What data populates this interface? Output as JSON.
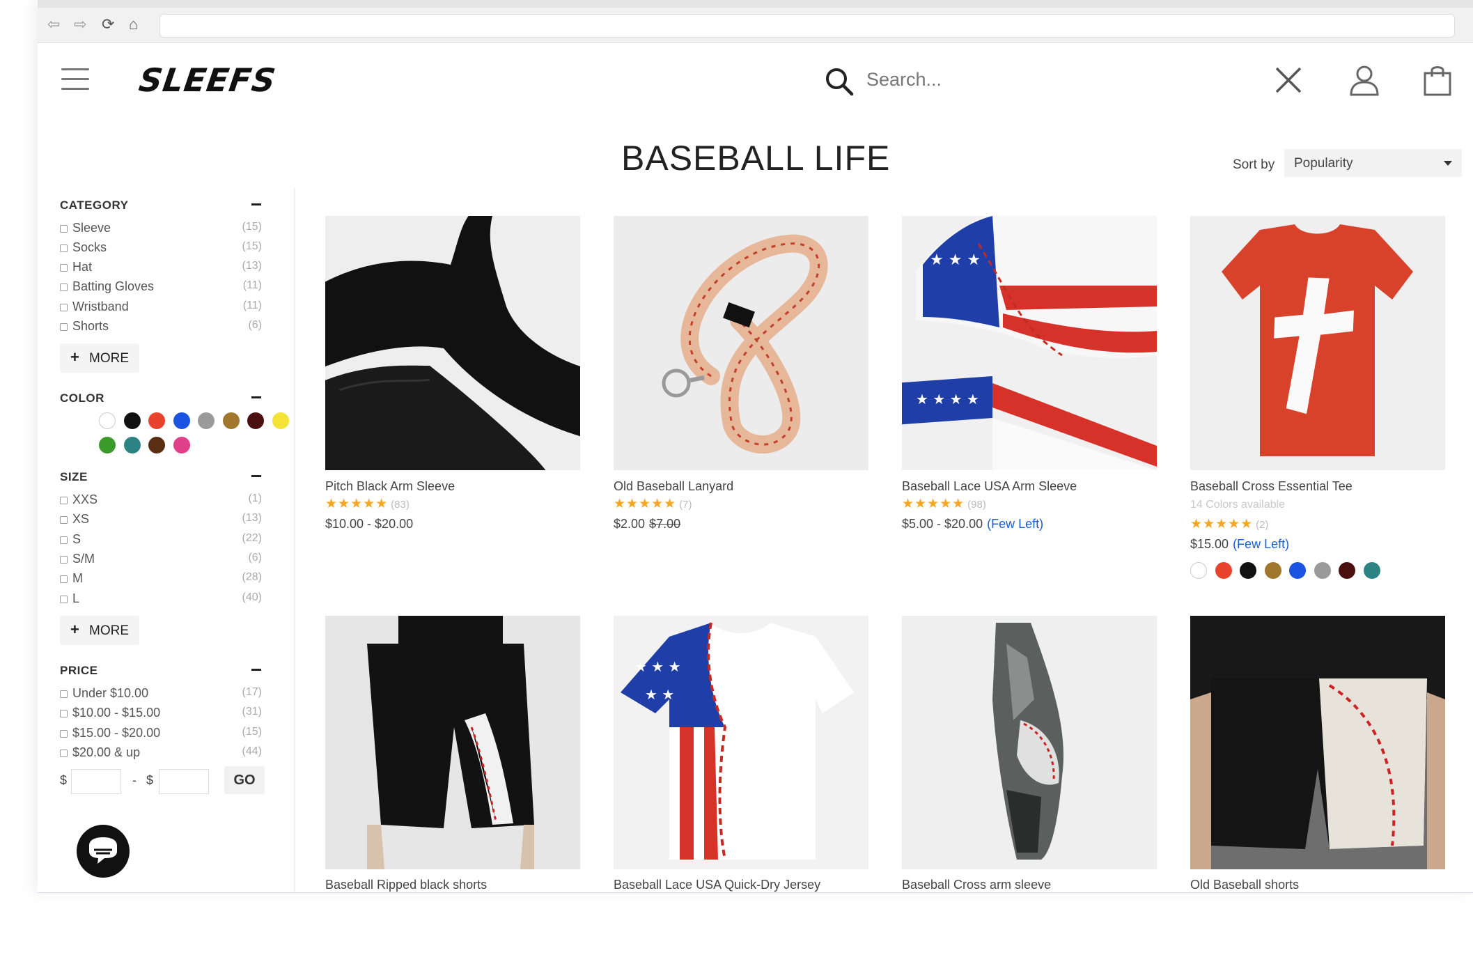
{
  "header": {
    "logo": "SLEEFS",
    "search_placeholder": "Search..."
  },
  "page": {
    "title": "BASEBALL LIFE",
    "sort_label": "Sort by",
    "sort_value": "Popularity"
  },
  "filters": {
    "category": {
      "heading": "CATEGORY",
      "items": [
        {
          "label": "Sleeve",
          "count": "(15)"
        },
        {
          "label": "Socks",
          "count": "(15)"
        },
        {
          "label": "Hat",
          "count": "(13)"
        },
        {
          "label": "Batting Gloves",
          "count": "(11)"
        },
        {
          "label": "Wristband",
          "count": "(11)"
        },
        {
          "label": "Shorts",
          "count": "(6)"
        }
      ],
      "more_label": "MORE"
    },
    "color": {
      "heading": "COLOR",
      "swatches": [
        "#ffffff",
        "#111111",
        "#e8432d",
        "#1a54e0",
        "#9a9a9a",
        "#a0772c",
        "#4a1010",
        "#f4e334",
        "#3a9a2a",
        "#2d8383",
        "#5a2e12",
        "#e0408a"
      ]
    },
    "size": {
      "heading": "SIZE",
      "items": [
        {
          "label": "XXS",
          "count": "(1)"
        },
        {
          "label": "XS",
          "count": "(13)"
        },
        {
          "label": "S",
          "count": "(22)"
        },
        {
          "label": "S/M",
          "count": "(6)"
        },
        {
          "label": "M",
          "count": "(28)"
        },
        {
          "label": "L",
          "count": "(40)"
        }
      ],
      "more_label": "MORE"
    },
    "price": {
      "heading": "PRICE",
      "items": [
        {
          "label": "Under $10.00",
          "count": "(17)"
        },
        {
          "label": "$10.00 - $15.00",
          "count": "(31)"
        },
        {
          "label": "$15.00 - $20.00",
          "count": "(15)"
        },
        {
          "label": "$20.00 & up",
          "count": "(44)"
        }
      ],
      "currency": "$",
      "dash": "-",
      "go_label": "GO"
    }
  },
  "products": [
    {
      "name": "Pitch Black Arm Sleeve",
      "stars": "★★★★★",
      "reviews": "(83)",
      "price": "$10.00 - $20.00",
      "old_price": "",
      "note": ""
    },
    {
      "name": "Old Baseball Lanyard",
      "stars": "★★★★★",
      "reviews": "(7)",
      "price": "$2.00",
      "old_price": "$7.00",
      "note": ""
    },
    {
      "name": "Baseball Lace USA Arm Sleeve",
      "stars": "★★★★★",
      "reviews": "(98)",
      "price": "$5.00 - $20.00",
      "old_price": "",
      "note": "(Few Left)"
    },
    {
      "name": "Baseball Cross Essential Tee",
      "sub": "14 Colors available",
      "stars": "★★★★★",
      "reviews": "(2)",
      "price": "$15.00",
      "old_price": "",
      "note": "(Few Left)",
      "colors": [
        "#ffffff",
        "#e8432d",
        "#111111",
        "#a0772c",
        "#1a54e0",
        "#9a9a9a",
        "#4a1010",
        "#2d8383"
      ]
    },
    {
      "name": "Baseball Ripped black shorts"
    },
    {
      "name": "Baseball Lace USA Quick-Dry Jersey"
    },
    {
      "name": "Baseball Cross arm sleeve"
    },
    {
      "name": "Old Baseball shorts"
    }
  ]
}
